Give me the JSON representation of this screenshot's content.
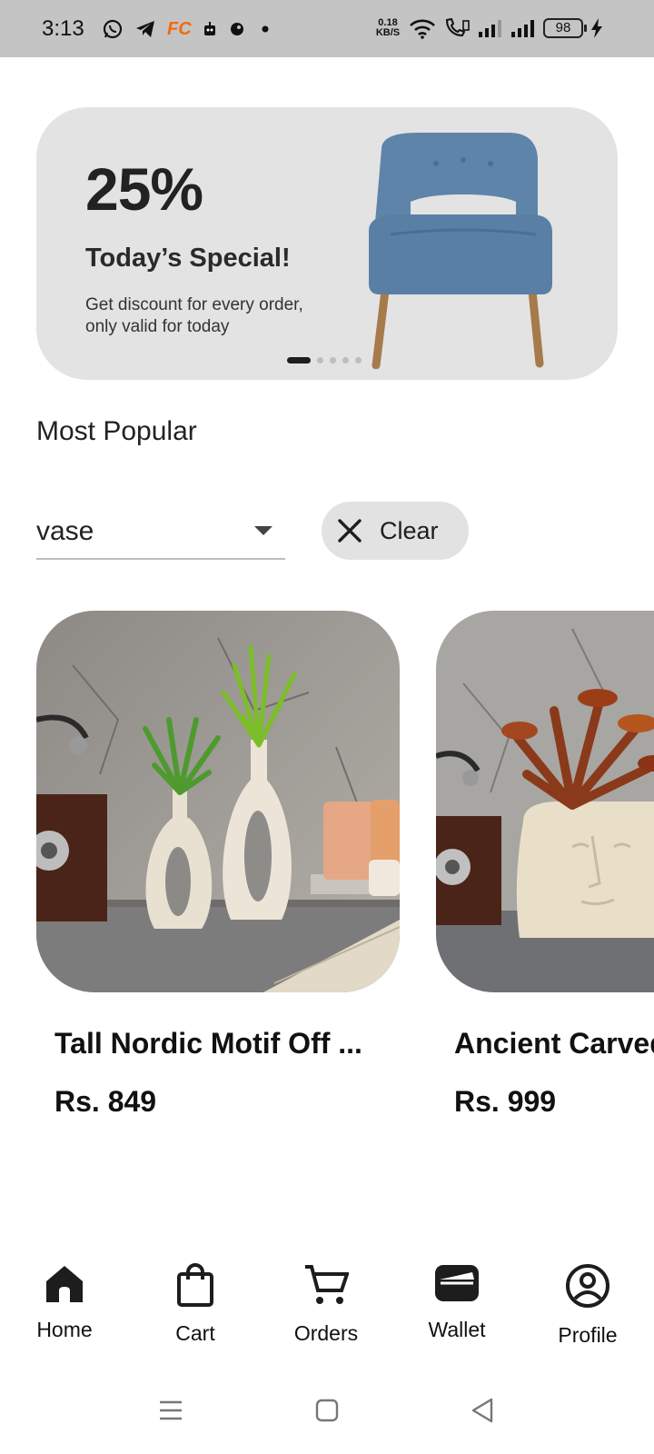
{
  "status_bar": {
    "time": "3:13",
    "net_speed_value": "0.18",
    "net_speed_unit": "KB/S",
    "battery": "98",
    "fc_badge": "FC"
  },
  "banner": {
    "percent": "25%",
    "title": "Today’s Special!",
    "description": "Get discount for every order, only valid for today",
    "slide_count": 5,
    "active_slide": 1
  },
  "section": {
    "title": "Most Popular"
  },
  "filter": {
    "selected": "vase",
    "clear_label": "Clear"
  },
  "products": [
    {
      "name": "Tall Nordic Motif Off ...",
      "price": "Rs. 849"
    },
    {
      "name": "Ancient Carved",
      "price": "Rs. 999"
    }
  ],
  "bottom_nav": [
    {
      "label": "Home",
      "icon": "home-icon",
      "active": true
    },
    {
      "label": "Cart",
      "icon": "shopping-bag-icon"
    },
    {
      "label": "Orders",
      "icon": "cart-icon"
    },
    {
      "label": "Wallet",
      "icon": "wallet-icon"
    },
    {
      "label": "Profile",
      "icon": "profile-icon"
    }
  ],
  "colors": {
    "status_bar": "#c4c4c4",
    "banner_bg": "#e3e3e3",
    "chip_bg": "#e2e2e2",
    "text": "#111111",
    "fc_badge": "#f26a0f"
  }
}
